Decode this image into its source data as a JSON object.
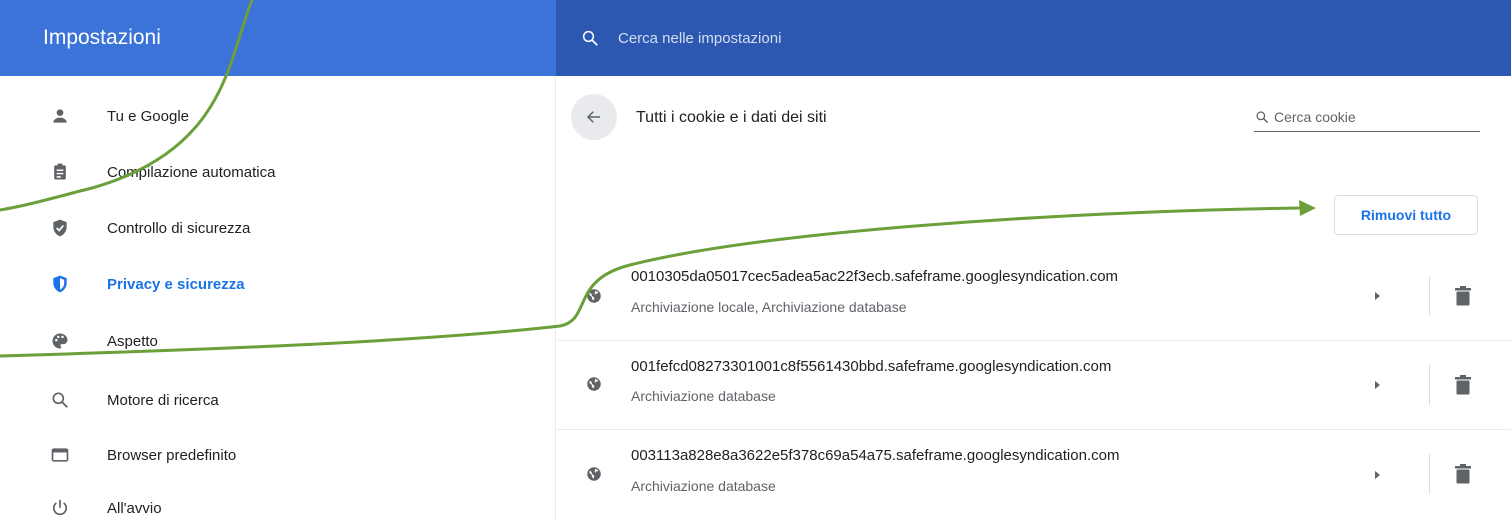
{
  "header": {
    "title": "Impostazioni",
    "search_placeholder": "Cerca nelle impostazioni",
    "search_icon": "search-icon"
  },
  "sidebar": {
    "items": [
      {
        "label": "Tu e Google",
        "icon": "person-icon"
      },
      {
        "label": "Compilazione automatica",
        "icon": "clipboard-icon"
      },
      {
        "label": "Controllo di sicurezza",
        "icon": "shield-check-icon"
      },
      {
        "label": "Privacy e sicurezza",
        "icon": "shield-icon",
        "active": true
      },
      {
        "label": "Aspetto",
        "icon": "palette-icon"
      },
      {
        "label": "Motore di ricerca",
        "icon": "search-icon"
      },
      {
        "label": "Browser predefinito",
        "icon": "browser-icon"
      },
      {
        "label": "All'avvio",
        "icon": "power-icon"
      }
    ]
  },
  "main": {
    "title": "Tutti i cookie e i dati dei siti",
    "search_placeholder": "Cerca cookie",
    "remove_all_label": "Rimuovi tutto",
    "sites": [
      {
        "domain": "0010305da05017cec5adea5ac22f3ecb.safeframe.googlesyndication.com",
        "storage": "Archiviazione locale, Archiviazione database"
      },
      {
        "domain": "001fefcd08273301001c8f5561430bbd.safeframe.googlesyndication.com",
        "storage": "Archiviazione database"
      },
      {
        "domain": "003113a828e8a3622e5f378c69a54a75.safeframe.googlesyndication.com",
        "storage": "Archiviazione database"
      }
    ]
  },
  "colors": {
    "header_left": "#3b73d9",
    "header_right": "#2d58b2",
    "accent": "#1a73e8",
    "annotation": "#6a9f3a"
  }
}
